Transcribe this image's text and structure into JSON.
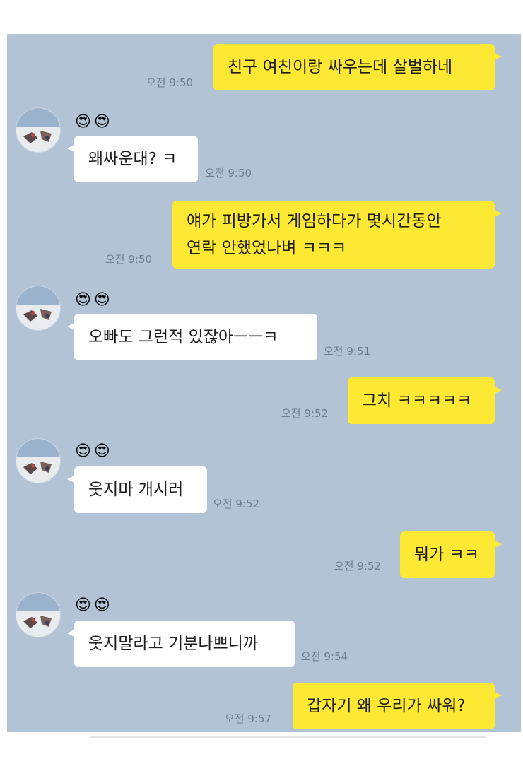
{
  "messages": [
    {
      "sender": "me",
      "text": "친구 여친이랑 싸우는데 살벌하네",
      "time": "오전 9:50"
    },
    {
      "sender": "other",
      "name": "😍😍",
      "text": "왜싸운대? ㅋ",
      "time": "오전 9:50"
    },
    {
      "sender": "me",
      "lines": [
        "얘가 피방가서 게임하다가 몇시간동안",
        "연락 안했었나벼 ㅋㅋㅋ"
      ],
      "time": "오전 9:50"
    },
    {
      "sender": "other",
      "name": "😍😍",
      "text": "오빠도 그런적 있잖아ㅡㅡㅋ",
      "time": "오전 9:51"
    },
    {
      "sender": "me",
      "text": "그치 ㅋㅋㅋㅋㅋ",
      "time": "오전 9:52"
    },
    {
      "sender": "other",
      "name": "😍😍",
      "text": "웃지마 개시러",
      "time": "오전 9:52"
    },
    {
      "sender": "me",
      "text": "뭐가 ㅋㅋ",
      "time": "오전 9:52"
    },
    {
      "sender": "other",
      "name": "😍😍",
      "text": "웃지말라고 기분나쁘니까",
      "time": "오전 9:54"
    },
    {
      "sender": "me",
      "text": "갑자기 왜 우리가 싸워?",
      "time": "오전 9:57"
    }
  ],
  "colors": {
    "chat_background": "#b1c3d5",
    "my_bubble": "#fde834",
    "other_bubble": "#ffffff"
  }
}
